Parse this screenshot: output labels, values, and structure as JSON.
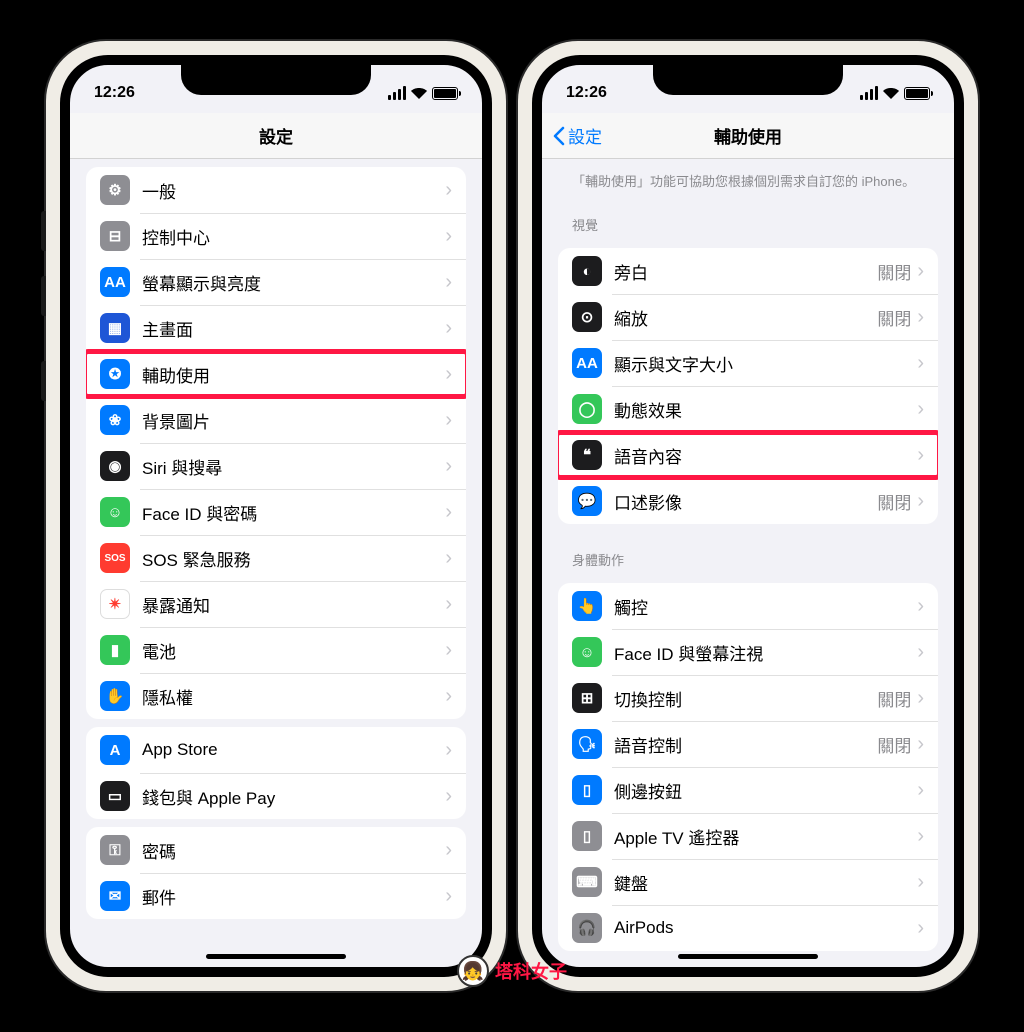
{
  "status": {
    "time": "12:26"
  },
  "watermark": "塔科女子",
  "phone1": {
    "nav_title": "設定",
    "groups": [
      {
        "rows": [
          {
            "key": "general",
            "label": "一般",
            "icon_bg": "bg-gray",
            "glyph": "⚙"
          },
          {
            "key": "control-center",
            "label": "控制中心",
            "icon_bg": "bg-gray",
            "glyph": "⊟"
          },
          {
            "key": "display",
            "label": "螢幕顯示與亮度",
            "icon_bg": "bg-blue",
            "glyph": "AA"
          },
          {
            "key": "home-screen",
            "label": "主畫面",
            "icon_bg": "bg-darkblue",
            "glyph": "▦"
          },
          {
            "key": "accessibility",
            "label": "輔助使用",
            "icon_bg": "bg-blue",
            "glyph": "✪",
            "highlight": true
          },
          {
            "key": "wallpaper",
            "label": "背景圖片",
            "icon_bg": "bg-blue",
            "glyph": "❀"
          },
          {
            "key": "siri",
            "label": "Siri 與搜尋",
            "icon_bg": "bg-black",
            "glyph": "◉"
          },
          {
            "key": "faceid",
            "label": "Face ID 與密碼",
            "icon_bg": "bg-green",
            "glyph": "☺"
          },
          {
            "key": "sos",
            "label": "SOS 緊急服務",
            "icon_bg": "bg-red",
            "glyph": "SOS"
          },
          {
            "key": "exposure",
            "label": "暴露通知",
            "icon_bg": "bg-white",
            "glyph": "✴"
          },
          {
            "key": "battery",
            "label": "電池",
            "icon_bg": "bg-green",
            "glyph": "▮"
          },
          {
            "key": "privacy",
            "label": "隱私權",
            "icon_bg": "bg-blue",
            "glyph": "✋"
          }
        ]
      },
      {
        "rows": [
          {
            "key": "appstore",
            "label": "App Store",
            "icon_bg": "bg-blue",
            "glyph": "A"
          },
          {
            "key": "wallet",
            "label": "錢包與 Apple Pay",
            "icon_bg": "bg-black",
            "glyph": "▭"
          }
        ]
      },
      {
        "rows": [
          {
            "key": "passwords",
            "label": "密碼",
            "icon_bg": "bg-gray",
            "glyph": "⚿"
          },
          {
            "key": "mail",
            "label": "郵件",
            "icon_bg": "bg-blue",
            "glyph": "✉"
          }
        ]
      }
    ]
  },
  "phone2": {
    "nav_back": "設定",
    "nav_title": "輔助使用",
    "note": "「輔助使用」功能可協助您根據個別需求自訂您的 iPhone。",
    "sections": [
      {
        "header": "視覺",
        "rows": [
          {
            "key": "voiceover",
            "label": "旁白",
            "value": "關閉",
            "icon_bg": "bg-black",
            "glyph": "◐"
          },
          {
            "key": "zoom",
            "label": "縮放",
            "value": "關閉",
            "icon_bg": "bg-black",
            "glyph": "⊙"
          },
          {
            "key": "display-text",
            "label": "顯示與文字大小",
            "icon_bg": "bg-blue",
            "glyph": "AA"
          },
          {
            "key": "motion",
            "label": "動態效果",
            "icon_bg": "bg-green",
            "glyph": "◯"
          },
          {
            "key": "spoken",
            "label": "語音內容",
            "icon_bg": "bg-black",
            "glyph": "❝",
            "highlight": true
          },
          {
            "key": "audio-desc",
            "label": "口述影像",
            "value": "關閉",
            "icon_bg": "bg-blue",
            "glyph": "💬"
          }
        ]
      },
      {
        "header": "身體動作",
        "rows": [
          {
            "key": "touch",
            "label": "觸控",
            "icon_bg": "bg-blue",
            "glyph": "👆"
          },
          {
            "key": "face-attention",
            "label": "Face ID 與螢幕注視",
            "icon_bg": "bg-green",
            "glyph": "☺"
          },
          {
            "key": "switch-control",
            "label": "切換控制",
            "value": "關閉",
            "icon_bg": "bg-black",
            "glyph": "⊞"
          },
          {
            "key": "voice-control",
            "label": "語音控制",
            "value": "關閉",
            "icon_bg": "bg-blue",
            "glyph": "🗣"
          },
          {
            "key": "side-button",
            "label": "側邊按鈕",
            "icon_bg": "bg-blue",
            "glyph": "▯"
          },
          {
            "key": "apple-tv",
            "label": "Apple TV 遙控器",
            "icon_bg": "bg-gray",
            "glyph": "▯"
          },
          {
            "key": "keyboard",
            "label": "鍵盤",
            "icon_bg": "bg-gray",
            "glyph": "⌨"
          },
          {
            "key": "airpods",
            "label": "AirPods",
            "icon_bg": "bg-gray",
            "glyph": "🎧"
          }
        ]
      }
    ]
  }
}
